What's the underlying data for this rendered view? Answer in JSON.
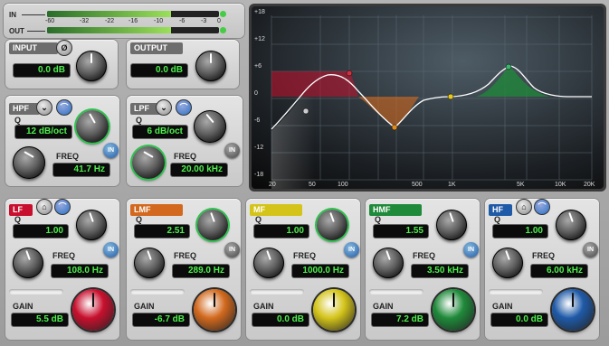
{
  "meters": {
    "in_label": "IN",
    "out_label": "OUT",
    "scale": [
      "-60",
      "-32",
      "-22",
      "-16",
      "-10",
      "-6",
      "-3",
      "0"
    ],
    "in_level": 0.72,
    "out_level": 0.72
  },
  "input": {
    "title": "INPUT",
    "value": "0.0 dB",
    "phase_icon": "Ø"
  },
  "output": {
    "title": "OUTPUT",
    "value": "0.0 dB"
  },
  "hpf": {
    "title": "HPF",
    "q_label": "Q",
    "slope": "12 dB/oct",
    "freq_label": "FREQ",
    "freq": "41.7 Hz",
    "in_label": "IN"
  },
  "lpf": {
    "title": "LPF",
    "q_label": "Q",
    "slope": "6 dB/oct",
    "freq_label": "FREQ",
    "freq": "20.00 kHz",
    "in_label": "IN"
  },
  "bands": [
    {
      "title": "LF",
      "q_label": "Q",
      "q": "1.00",
      "freq_label": "FREQ",
      "freq": "108.0 Hz",
      "gain_label": "GAIN",
      "gain": "5.5 dB",
      "in_label": "IN",
      "color": "#c8102e"
    },
    {
      "title": "LMF",
      "q_label": "Q",
      "q": "2.51",
      "freq_label": "FREQ",
      "freq": "289.0 Hz",
      "gain_label": "GAIN",
      "gain": "-6.7 dB",
      "in_label": "IN",
      "color": "#d2691e"
    },
    {
      "title": "MF",
      "q_label": "Q",
      "q": "1.00",
      "freq_label": "FREQ",
      "freq": "1000.0 Hz",
      "gain_label": "GAIN",
      "gain": "0.0 dB",
      "in_label": "IN",
      "color": "#d4c41a"
    },
    {
      "title": "HMF",
      "q_label": "Q",
      "q": "1.55",
      "freq_label": "FREQ",
      "freq": "3.50 kHz",
      "gain_label": "GAIN",
      "gain": "7.2 dB",
      "in_label": "IN",
      "color": "#1f8a3a"
    },
    {
      "title": "HF",
      "q_label": "Q",
      "q": "1.00",
      "freq_label": "FREQ",
      "freq": "6.00 kHz",
      "gain_label": "GAIN",
      "gain": "0.0 dB",
      "in_label": "IN",
      "color": "#1f5aa8"
    }
  ],
  "graph": {
    "db_labels": [
      "+18",
      "+12",
      "+6",
      "0",
      "-6",
      "-12",
      "-18"
    ],
    "freq_labels": [
      "20",
      "50",
      "100",
      "500",
      "1K",
      "5K",
      "10K",
      "20K"
    ]
  }
}
